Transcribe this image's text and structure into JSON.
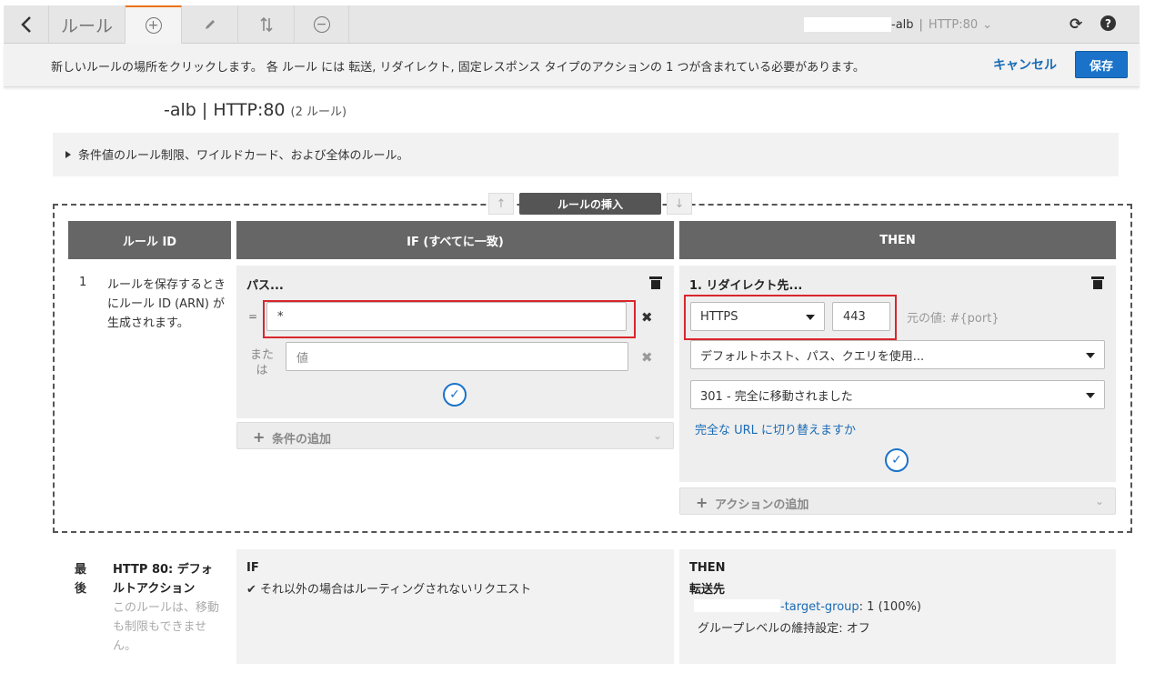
{
  "toolbar": {
    "title": "ルール",
    "listener_name": "-alb",
    "listener_sep": "|",
    "listener_proto": "HTTP:80",
    "listener_caret": "⌄"
  },
  "message": {
    "text": "新しいルールの場所をクリックします。 各 ルール には 転送, リダイレクト, 固定レスポンス タイプのアクションの 1 つが含まれている必要があります。",
    "cancel": "キャンセル",
    "save": "保存"
  },
  "heading": {
    "listener": "-alb | HTTP:80",
    "count": "(2 ルール)"
  },
  "info": {
    "text": "条件値のルール制限、ワイルドカード、および全体のルール。"
  },
  "insert": {
    "label": "ルールの挿入",
    "up": "↑",
    "down": "↓"
  },
  "columns": {
    "rule_id": "ルール ID",
    "if": "IF (すべてに一致)",
    "then": "THEN"
  },
  "rule1": {
    "number": "1",
    "id_note": "ルールを保存するときにルール ID (ARN) が生成されます。",
    "condition": {
      "title": "パス...",
      "operator": "=",
      "value": "*",
      "or_label": "または",
      "or_placeholder": "値",
      "add_condition": "条件の追加"
    },
    "action": {
      "title": "1. リダイレクト先...",
      "protocol": "HTTPS",
      "port": "443",
      "original": "元の値: #{port}",
      "host_option": "デフォルトホスト、パス、クエリを使用...",
      "status_option": "301 - 完全に移動されました",
      "switch_url": "完全な URL に切り替えますか",
      "add_action": "アクションの追加"
    }
  },
  "last_rule": {
    "label": "最後",
    "title": "HTTP 80: デフォルトアクション",
    "note": "このルールは、移動も制限もできません。",
    "if_heading": "IF",
    "if_text": "それ以外の場合はルーティングされないリクエスト",
    "then_heading": "THEN",
    "forward_label": "転送先",
    "target_name": "-target-group",
    "target_weight": ": 1 (100%)",
    "stickiness": "グループレベルの維持設定: オフ"
  },
  "colors": {
    "accent": "#ec7211",
    "primary": "#1b73c9",
    "link": "#1a6bb5",
    "highlight": "#d9262c",
    "header_bg": "#666666"
  }
}
